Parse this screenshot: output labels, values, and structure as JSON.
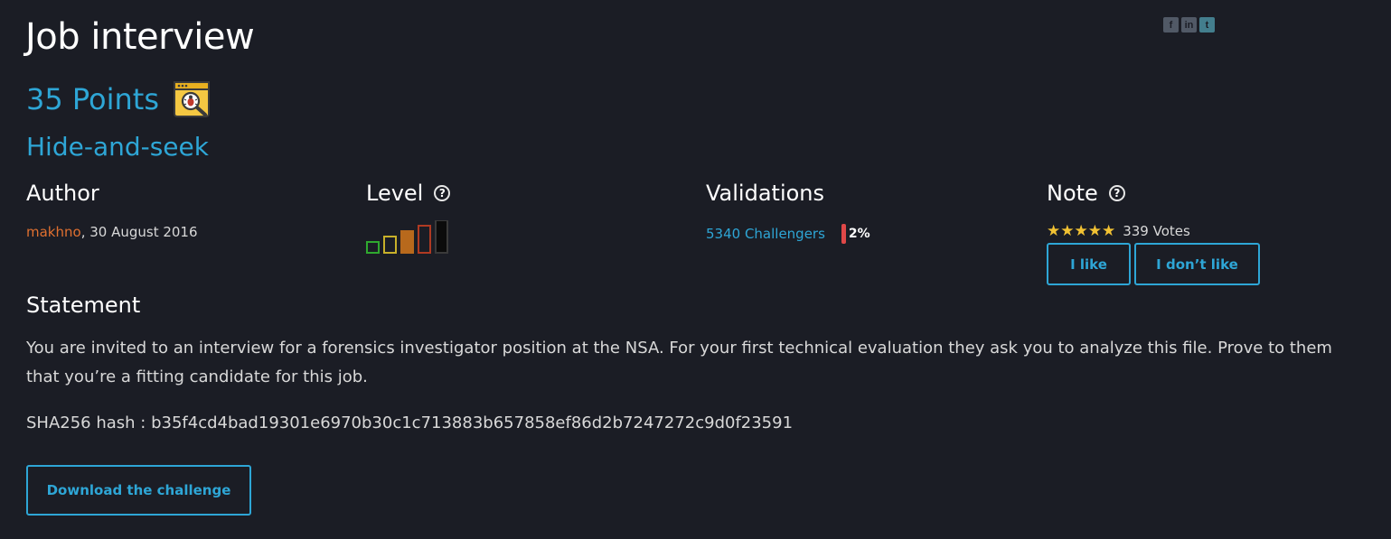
{
  "challenge": {
    "title": "Job interview",
    "points": "35 Points",
    "category": "Hide-and-seek"
  },
  "social": [
    {
      "icon": "facebook-icon",
      "glyph": "f"
    },
    {
      "icon": "linkedin-icon",
      "glyph": "in"
    },
    {
      "icon": "twitter-icon",
      "glyph": "t"
    }
  ],
  "author": {
    "heading": "Author",
    "name": "makhno",
    "date": ",  30 August 2016"
  },
  "level": {
    "heading": "Level",
    "help_icon": "?",
    "current_level": 3,
    "max_level": 5,
    "colors": [
      "#2fa82f",
      "#c8b02a",
      "#b8691c",
      "#b03a22",
      "#0b0b0b"
    ]
  },
  "validations": {
    "heading": "Validations",
    "challengers": "5340 Challengers",
    "percent": "2%"
  },
  "note": {
    "heading": "Note",
    "help_icon": "?",
    "stars": "★★★★★",
    "votes": "339 Votes",
    "like_label": "I like",
    "dislike_label": "I don’t like"
  },
  "statement": {
    "heading": "Statement",
    "text": "You are invited to an interview for a forensics investigator position at the NSA. For your first technical evaluation they ask you to analyze this file. Prove to them that you’re a fitting candidate for this job.",
    "hash": "SHA256 hash : b35f4cd4bad19301e6970b30c1c713883b657858ef86d2b7247272c9d0f23591"
  },
  "actions": {
    "download_label": "Download the challenge"
  },
  "theme": {
    "accent": "#2ea6d6",
    "author_color": "#e07030",
    "background": "#1b1d25"
  }
}
